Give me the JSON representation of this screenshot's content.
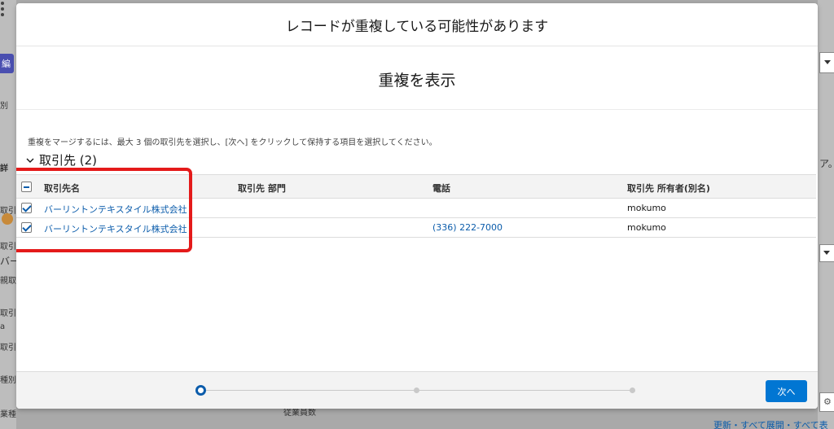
{
  "modal": {
    "title": "レコードが重複している可能性があります",
    "subtitle": "重複を表示",
    "instructions": "重複をマージするには、最大 3 個の取引先を選択し、[次へ] をクリックして保持する項目を選択してください。",
    "section": {
      "title": "取引先 (2)",
      "expanded": true
    },
    "table": {
      "columns": [
        "取引先名",
        "取引先 部門",
        "電話",
        "取引先 所有者(別名)"
      ],
      "rows": [
        {
          "checked": true,
          "name": "バーリントンテキスタイル株式会社",
          "division": "",
          "phone": "",
          "owner": "mokumo"
        },
        {
          "checked": true,
          "name": "バーリントンテキスタイル株式会社",
          "division": "",
          "phone": "(336) 222-7000",
          "owner": "mokumo"
        }
      ],
      "select_all_state": "mixed"
    },
    "progress": {
      "current_step": 1,
      "total_steps": 3
    },
    "next_label": "次へ"
  },
  "background": {
    "left_fragments": [
      "編",
      "別",
      "詳",
      "取引",
      "取引",
      "バー",
      "親取",
      "取引",
      "a",
      "取引",
      "種別",
      "業種"
    ],
    "right_fragments": [
      "ア。"
    ],
    "bottom_mid": "従業員数",
    "links": "更新・すべて展開・すべて表"
  },
  "colors": {
    "brand_blue": "#0176d3",
    "link_blue": "#0b5cab",
    "highlight_red": "#e41a1a"
  }
}
